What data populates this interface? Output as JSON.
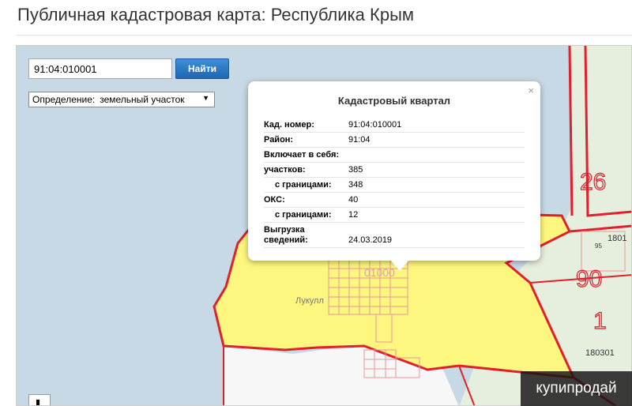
{
  "page": {
    "title": "Публичная кадастровая карта: Республика Крым"
  },
  "search": {
    "value": "91:04:010001",
    "button_label": "Найти"
  },
  "definition_select": {
    "label": "Определение:",
    "value": "земельный участок"
  },
  "map_labels": {
    "quarter": "01000",
    "locality": "Лукулл",
    "lot_26": "26",
    "lot_90": "90",
    "lot_1": "1",
    "code_180301": "180301",
    "code_1801": "1801",
    "num_95": "95"
  },
  "popup": {
    "title": "Кадастровый квартал",
    "close": "×",
    "rows": [
      {
        "key": "Кад. номер:",
        "value": "91:04:010001",
        "indent": false
      },
      {
        "key": "Район:",
        "value": "91:04",
        "indent": false
      },
      {
        "key": "Включает в себя:",
        "value": "",
        "indent": false
      },
      {
        "key": "участков:",
        "value": "385",
        "indent": false
      },
      {
        "key": "с границами:",
        "value": "348",
        "indent": true
      },
      {
        "key": "ОКС:",
        "value": "40",
        "indent": false
      },
      {
        "key": "с границами:",
        "value": "12",
        "indent": true
      },
      {
        "key": "Выгрузка сведений:",
        "value": "24.03.2019",
        "indent": false
      }
    ]
  },
  "watermark": {
    "text": "купипродай"
  },
  "colors": {
    "sea": "#c7d9e4",
    "quarter_fill": "#fdf67f",
    "boundary": "#e0202c",
    "adjacent_land": "#e6eedd",
    "button": "#2a7ac4"
  }
}
